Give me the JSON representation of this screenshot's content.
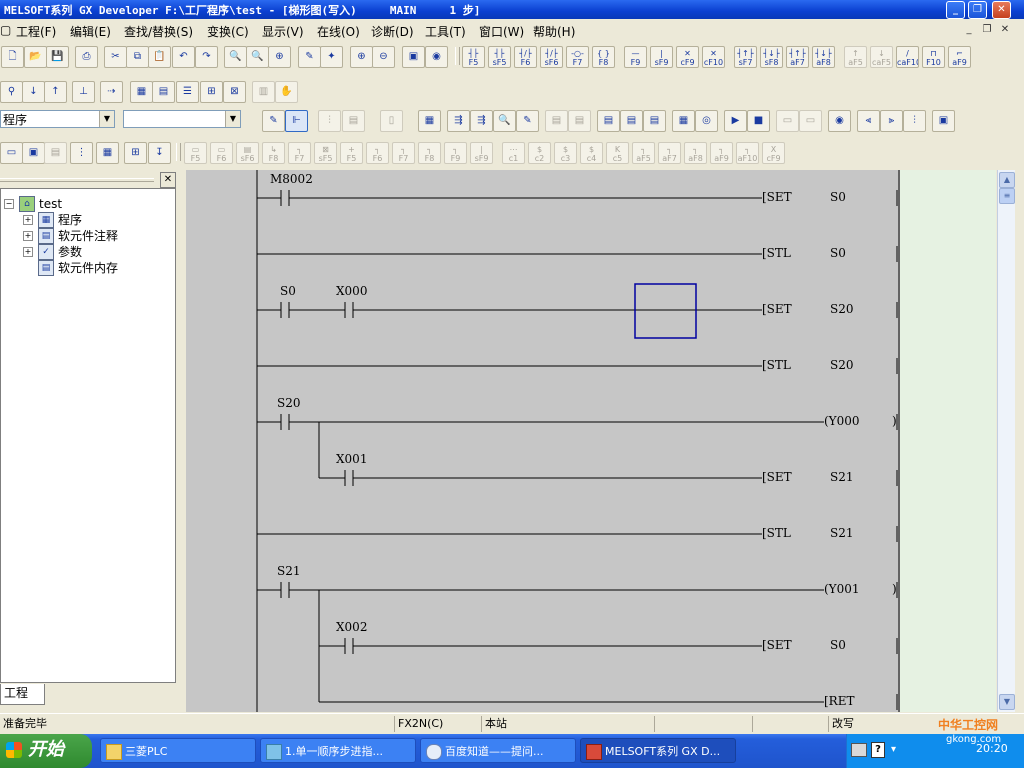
{
  "window": {
    "title": "MELSOFT系列 GX Developer F:\\工厂程序\\test - [梯形图(写入)     MAIN     1 步]"
  },
  "menu": [
    "工程(F)",
    "编辑(E)",
    "查找/替换(S)",
    "变换(C)",
    "显示(V)",
    "在线(O)",
    "诊断(D)",
    "工具(T)",
    "窗口(W)",
    "帮助(H)"
  ],
  "toolbar_keys_row1": [
    "F5",
    "sF5",
    "F6",
    "sF6",
    "F7",
    "F8",
    "F9",
    "sF9",
    "cF9",
    "cF10",
    "sF7",
    "sF8",
    "aF7",
    "aF8",
    "aF5",
    "caF5",
    "caF10",
    "F10",
    "aF9"
  ],
  "toolbar_keys_row4": [
    "F5",
    "F6",
    "sF6",
    "F8",
    "F7",
    "sF5",
    "F5",
    "F6",
    "F7",
    "F8",
    "F9",
    "sF9",
    "c1",
    "c2",
    "c3",
    "c4",
    "c5",
    "aF5",
    "aF7",
    "aF8",
    "aF9",
    "aF10",
    "cF9"
  ],
  "combos": {
    "data_type": "程序",
    "program": ""
  },
  "tree": {
    "root": "test",
    "items": [
      "程序",
      "软元件注释",
      "参数",
      "软元件内存"
    ],
    "tab": "工程"
  },
  "ladder": {
    "contacts": [
      "M8002",
      "S0",
      "X000",
      "S20",
      "X001",
      "S21",
      "X002"
    ],
    "instructions": [
      {
        "op": "[SET",
        "arg": "S0"
      },
      {
        "op": "[STL",
        "arg": "S0"
      },
      {
        "op": "[SET",
        "arg": "S20"
      },
      {
        "op": "[STL",
        "arg": "S20"
      },
      {
        "op": "(Y000",
        "arg": ""
      },
      {
        "op": "[SET",
        "arg": "S21"
      },
      {
        "op": "[STL",
        "arg": "S21"
      },
      {
        "op": "(Y001",
        "arg": ""
      },
      {
        "op": "[SET",
        "arg": "S0"
      },
      {
        "op": "[RET",
        "arg": ""
      }
    ]
  },
  "status": {
    "message": "准备完毕",
    "plc_type": "FX2N(C)",
    "station": "本站",
    "mode": "改写"
  },
  "taskbar": {
    "start": "开始",
    "tasks": [
      "三菱PLC",
      "1.单一顺序步进指...",
      "百度知道——提问...",
      "MELSOFT系列 GX D..."
    ],
    "clock": "20:20"
  },
  "watermark": {
    "text": "中华工控网",
    "url": "gkong.com"
  }
}
